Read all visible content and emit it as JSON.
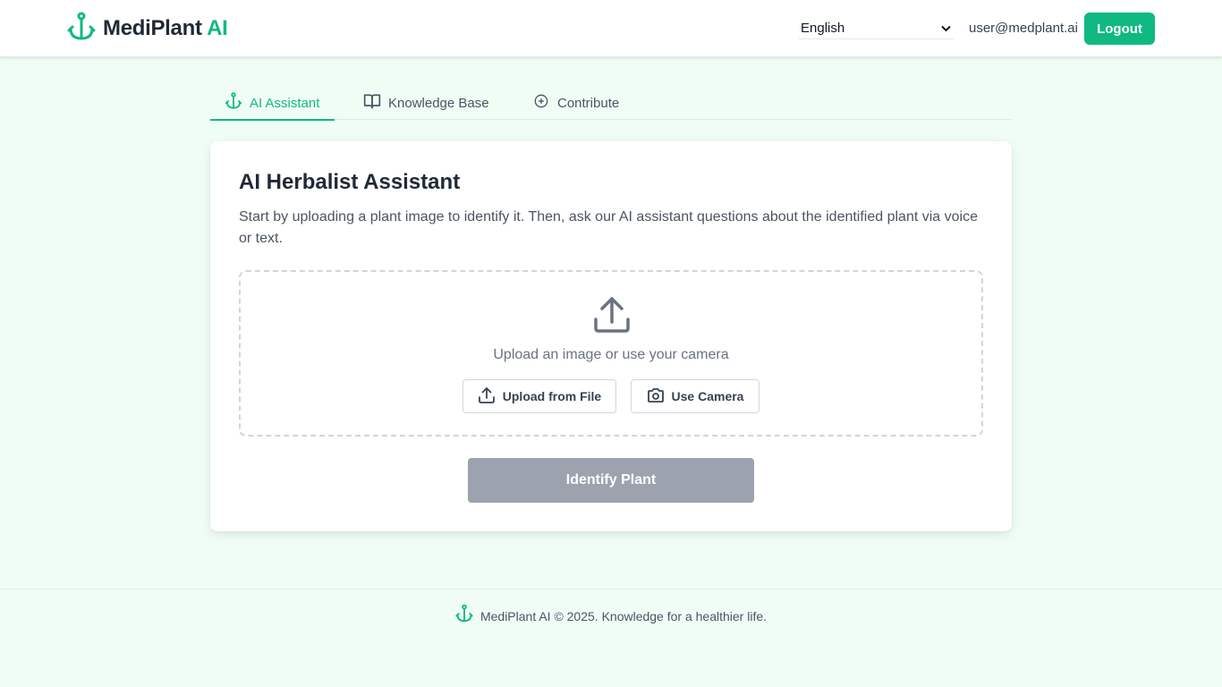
{
  "header": {
    "brand_name": "MediPlant",
    "brand_accent": "AI",
    "language": "English",
    "user_email": "user@medplant.ai",
    "logout_label": "Logout"
  },
  "tabs": [
    {
      "label": "AI Assistant",
      "icon": "plant-anchor-icon",
      "active": true
    },
    {
      "label": "Knowledge Base",
      "icon": "book-icon",
      "active": false
    },
    {
      "label": "Contribute",
      "icon": "plus-circle-icon",
      "active": false
    }
  ],
  "assistant": {
    "title": "AI Herbalist Assistant",
    "description": "Start by uploading a plant image to identify it. Then, ask our AI assistant questions about the identified plant via voice or text.",
    "dropzone_text": "Upload an image or use your camera",
    "upload_file_label": "Upload from File",
    "use_camera_label": "Use Camera",
    "identify_label": "Identify Plant"
  },
  "footer": {
    "text": "MediPlant AI © 2025. Knowledge for a healthier life."
  },
  "colors": {
    "accent": "#10b981",
    "page_background": "#f0fdf4",
    "disabled_button": "#9ca3af"
  }
}
